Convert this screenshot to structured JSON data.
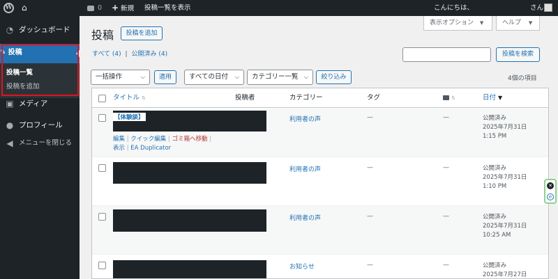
{
  "adminbar": {
    "comments_count": "0",
    "new_label": "新規",
    "view_posts": "投稿一覧を表示",
    "greeting": "こんにちは、",
    "user_suffix": "さん"
  },
  "sidebar": {
    "items": [
      {
        "label": "ダッシュボード",
        "icon": "dashboard-icon"
      },
      {
        "label": "投稿",
        "icon": "pushpin-icon"
      },
      {
        "label": "メディア",
        "icon": "media-icon"
      },
      {
        "label": "プロフィール",
        "icon": "user-icon"
      },
      {
        "label": "メニューを閉じる",
        "icon": "collapse-icon"
      }
    ],
    "submenu": [
      {
        "label": "投稿一覧",
        "current": true
      },
      {
        "label": "投稿を追加",
        "current": false
      }
    ],
    "highlight_color": "#e1131e"
  },
  "header": {
    "title": "投稿",
    "add_new": "投稿を追加",
    "screen_options": "表示オプション",
    "help": "ヘルプ"
  },
  "filters": {
    "all_label": "すべて",
    "all_count": "(4)",
    "published_label": "公開済み",
    "published_count": "(4)",
    "search_value": "",
    "search_button": "投稿を検索",
    "bulk_action": "一括操作",
    "apply": "適用",
    "date_filter": "すべての日付",
    "category_filter": "カテゴリー一覧",
    "filter_button": "絞り込み",
    "item_count": "4個の項目"
  },
  "table": {
    "columns": {
      "title": "タイトル",
      "author": "投稿者",
      "categories": "カテゴリー",
      "tags": "タグ",
      "date": "日付"
    },
    "rows": [
      {
        "title_tag": "【体験談】",
        "category": "利用者の声",
        "tags": "—",
        "comments": "—",
        "status": "公開済み",
        "date": "2025年7月31日",
        "time": "1:15 PM",
        "actions": {
          "edit": "編集",
          "quick_edit": "クイック編集",
          "trash": "ゴミ箱へ移動",
          "view": "表示",
          "duplicate": "EA Duplicator"
        }
      },
      {
        "category": "利用者の声",
        "tags": "—",
        "comments": "—",
        "status": "公開済み",
        "date": "2025年7月31日",
        "time": "1:10 PM"
      },
      {
        "category": "利用者の声",
        "tags": "—",
        "comments": "—",
        "status": "公開済み",
        "date": "2025年7月31日",
        "time": "10:25 AM"
      },
      {
        "category": "お知らせ",
        "tags": "—",
        "comments": "—",
        "status": "公開済み",
        "date": "2025年7月27日",
        "time": ""
      }
    ]
  }
}
